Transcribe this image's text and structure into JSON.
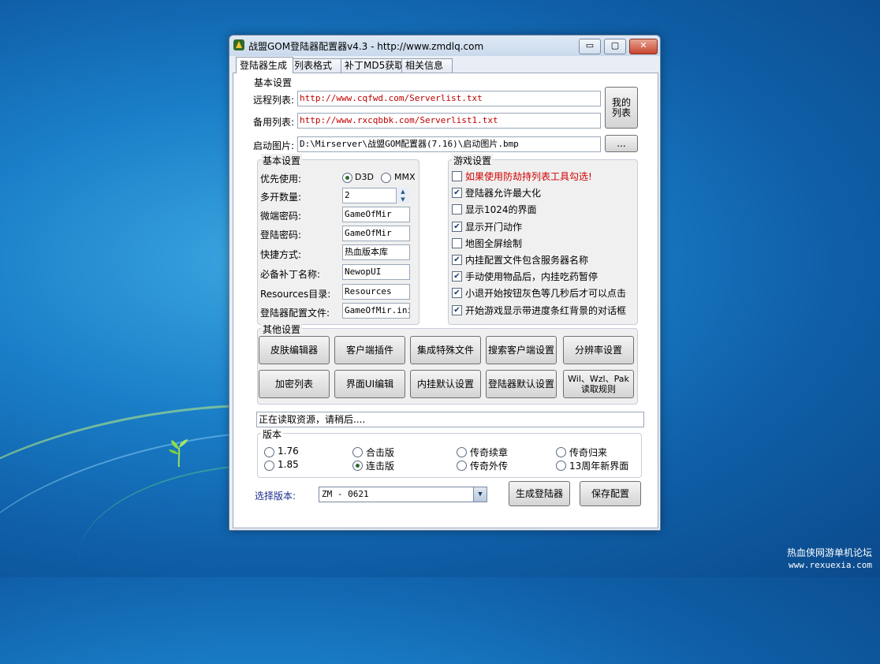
{
  "window": {
    "title": "战盟GOM登陆器配置器v4.3 - http://www.zmdlq.com",
    "min": "▭",
    "max": "▢",
    "close": "✕"
  },
  "tabs": [
    "登陆器生成",
    "列表格式",
    "补丁MD5获取",
    "相关信息"
  ],
  "basic": {
    "title": "基本设置",
    "remote_label": "远程列表:",
    "remote_value": "http://www.cqfwd.com/Serverlist.txt",
    "backup_label": "备用列表:",
    "backup_value": "http://www.rxcqbbk.com/Serverlist1.txt",
    "my_list_btn": "我的\n列表",
    "startup_label": "启动图片:",
    "startup_value": "D:\\Mirserver\\战盟GOM配置器(7.16)\\启动图片.bmp",
    "browse_btn": "..."
  },
  "settings": {
    "title": "基本设置",
    "priority_label": "优先使用:",
    "priority_opt1": "D3D",
    "priority_opt2": "MMX",
    "multi_label": "多开数量:",
    "multi_value": "2",
    "micro_pw_label": "微端密码:",
    "micro_pw_value": "GameOfMir",
    "login_pw_label": "登陆密码:",
    "login_pw_value": "GameOfMir",
    "shortcut_label": "快捷方式:",
    "shortcut_value": "热血版本库",
    "patch_label": "必备补丁名称:",
    "patch_value": "NewopUI",
    "res_label": "Resources目录:",
    "res_value": "Resources",
    "cfg_label": "登陆器配置文件:",
    "cfg_value": "GameOfMir.ini"
  },
  "game": {
    "title": "游戏设置",
    "items": [
      {
        "label": "如果使用防劫持列表工具勾选!",
        "checked": false,
        "red": true
      },
      {
        "label": "登陆器允许最大化",
        "checked": true
      },
      {
        "label": "显示1024的界面",
        "checked": false
      },
      {
        "label": "显示开门动作",
        "checked": true
      },
      {
        "label": "地图全屏绘制",
        "checked": false
      },
      {
        "label": "内挂配置文件包含服务器名称",
        "checked": true
      },
      {
        "label": "手动使用物品后，内挂吃药暂停",
        "checked": true
      },
      {
        "label": "小退开始按钮灰色等几秒后才可以点击",
        "checked": true
      },
      {
        "label": "开始游戏显示带进度条红背景的对话框",
        "checked": true
      }
    ]
  },
  "other": {
    "title": "其他设置",
    "buttons": [
      "皮肤编辑器",
      "客户端插件",
      "集成特殊文件",
      "搜索客户端设置",
      "分辨率设置",
      "加密列表",
      "界面UI编辑",
      "内挂默认设置",
      "登陆器默认设置",
      "Wil、Wzl、Pak\n读取规则"
    ]
  },
  "status": "正在读取资源，请稍后....",
  "version": {
    "title": "版本",
    "options": [
      "1.76",
      "合击版",
      "传奇续章",
      "传奇归来",
      "1.85",
      "连击版",
      "传奇外传",
      "13周年新界面"
    ],
    "selected": "连击版"
  },
  "select": {
    "label": "选择版本:",
    "value": "ZM - 0621"
  },
  "actions": {
    "generate": "生成登陆器",
    "save": "保存配置"
  },
  "watermark": {
    "line1": "热血侠网游单机论坛",
    "line2": "www.rexuexia.com"
  }
}
